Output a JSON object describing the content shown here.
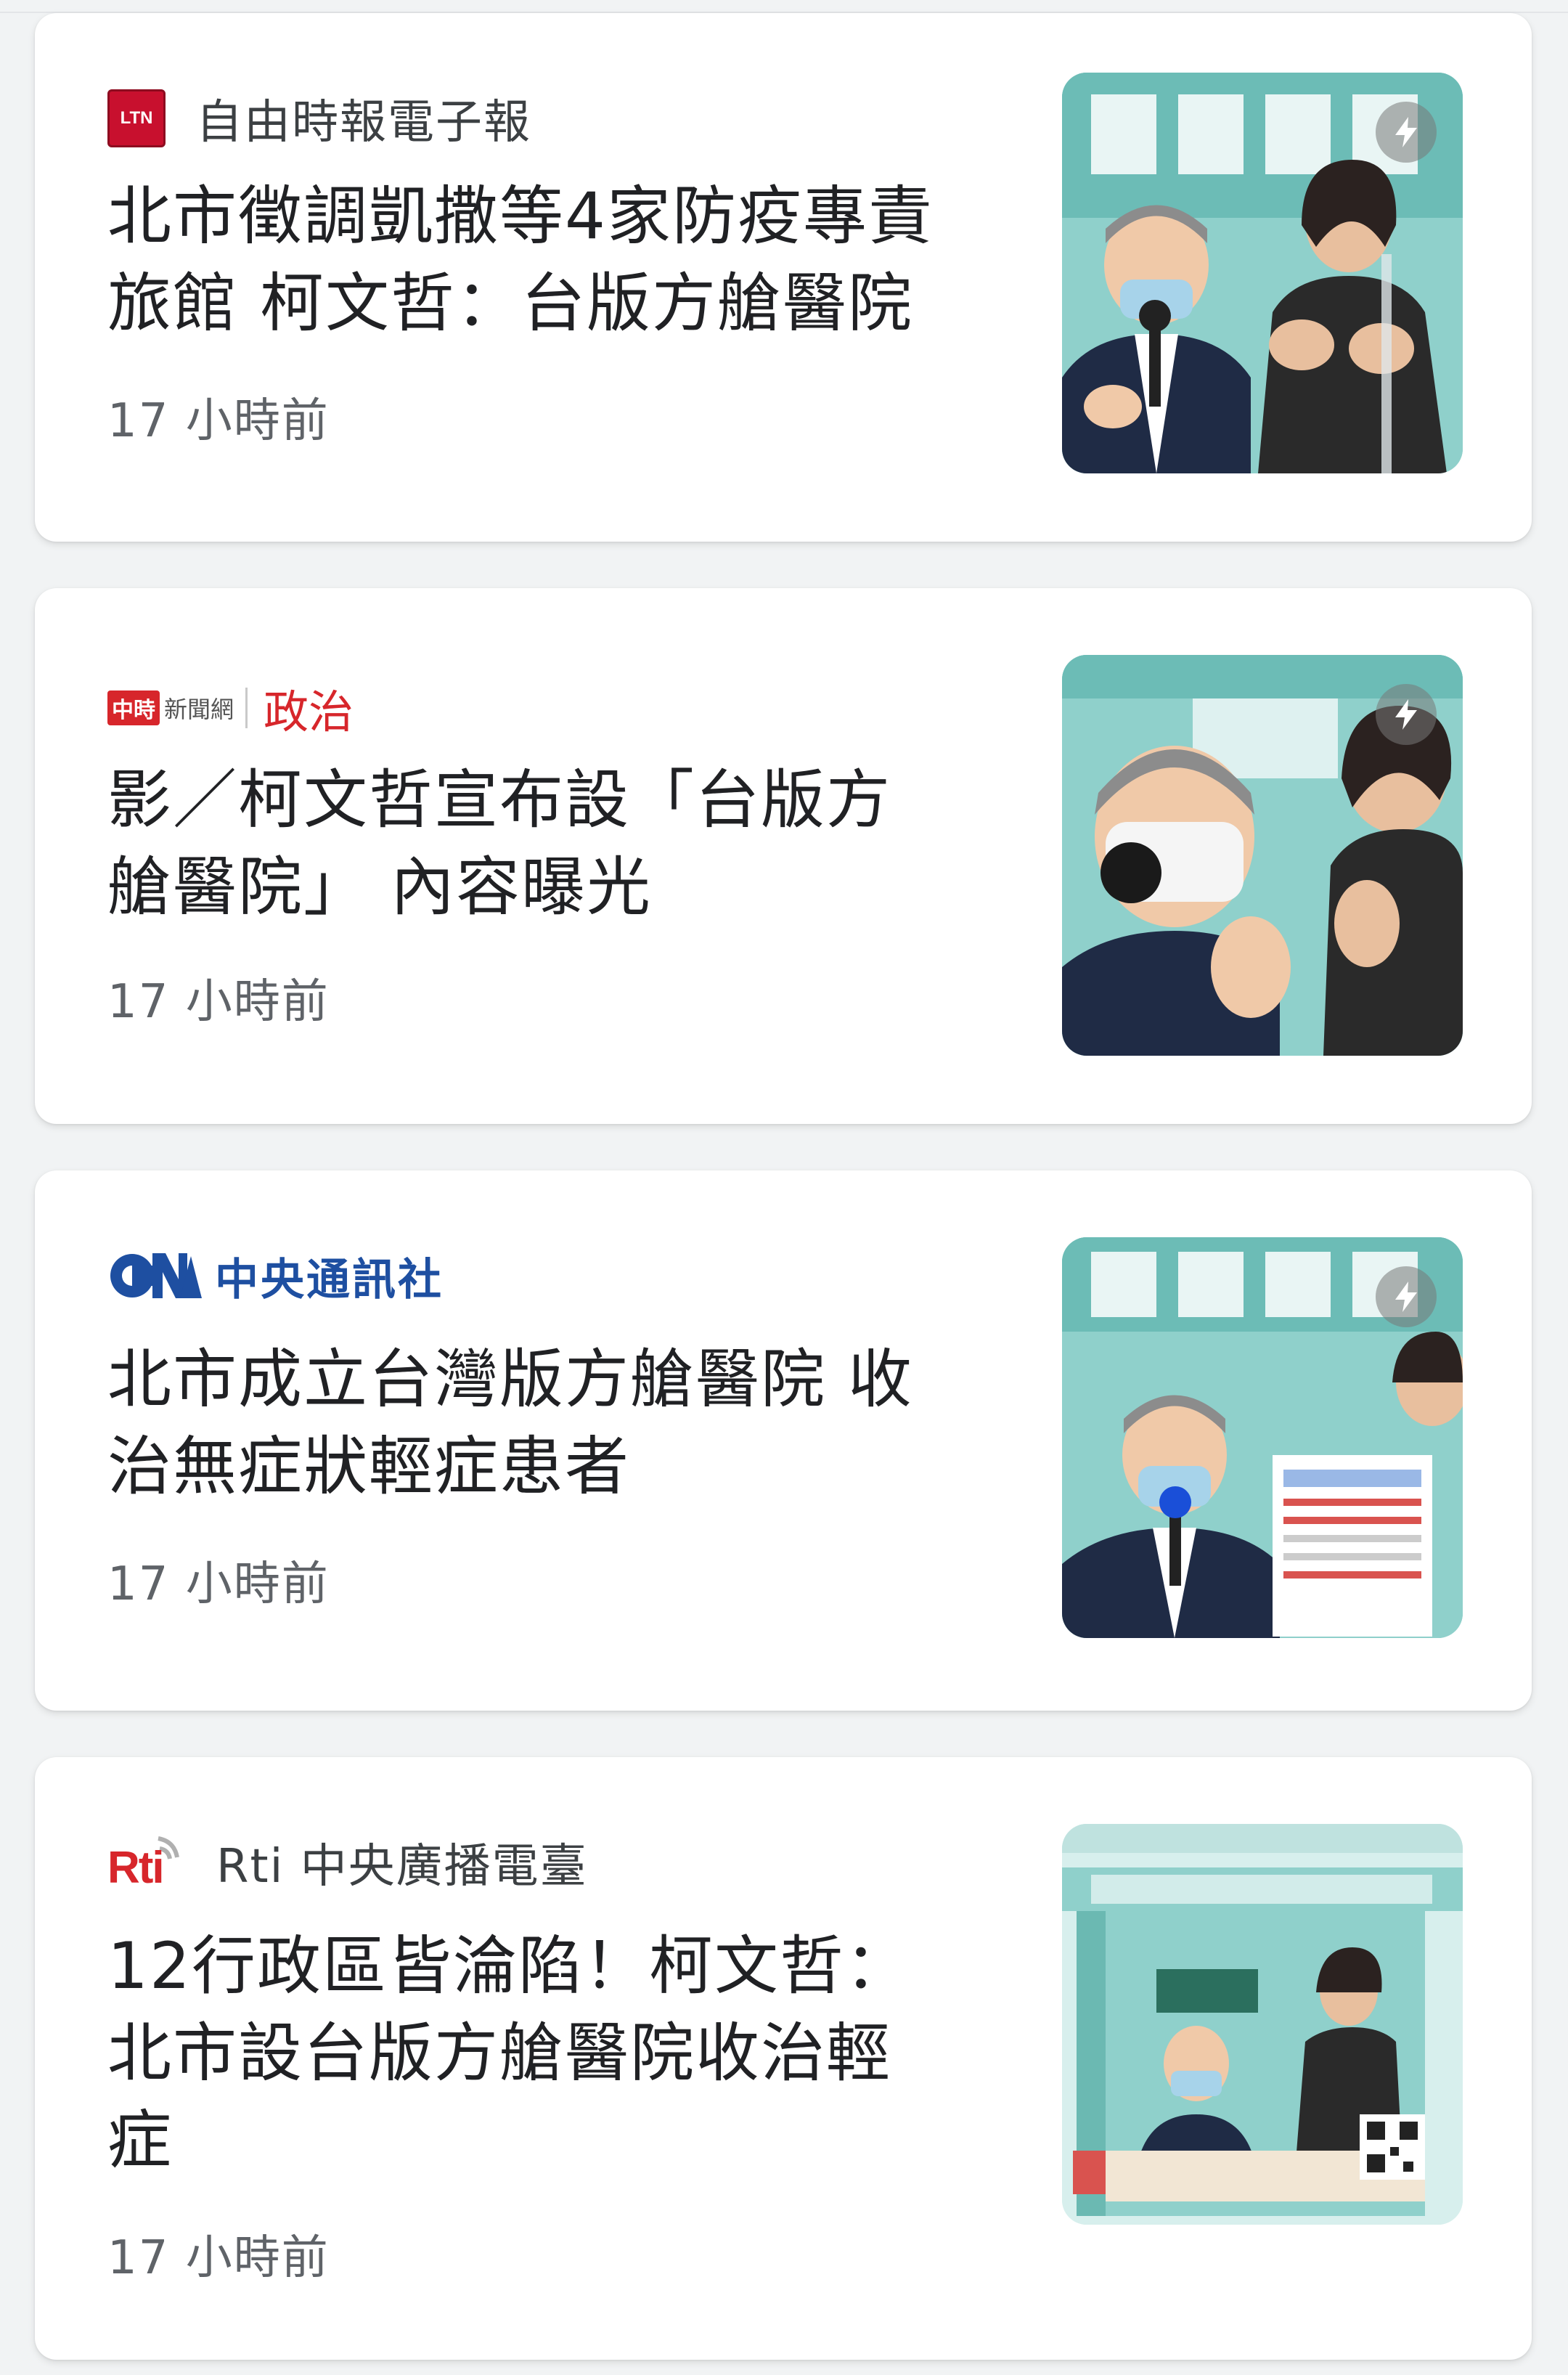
{
  "articles": [
    {
      "source": "自由時報電子報",
      "source_logo_text": "LTN",
      "source_logo_icon": "ltn-logo",
      "headline_line1": "北市徵調凱撒等4家防疫專責",
      "headline_line2": "旅館 柯文哲：台版方艙醫院",
      "time": "17 小時前",
      "thumbnail": "press-conference-photo",
      "amp": true
    },
    {
      "source": "中時新聞網",
      "source_logo_box": "中時",
      "source_logo_text": "新聞網",
      "source_section": "政治",
      "headline_line1": "影／柯文哲宣布設「台版方",
      "headline_line2": "艙醫院」 內容曝光",
      "time": "17 小時前",
      "thumbnail": "press-conference-photo",
      "amp": true
    },
    {
      "source": "中央通訊社",
      "source_logo_icon": "cna-logo",
      "headline_line1": "北市成立台灣版方艙醫院 收",
      "headline_line2": "治無症狀輕症患者",
      "time": "17 小時前",
      "thumbnail": "press-conference-photo",
      "amp": true
    },
    {
      "source": "Rti 中央廣播電臺",
      "source_logo_text": "Rti",
      "source_logo_icon": "rti-logo",
      "headline_line1": "12行政區皆淪陷！柯文哲：",
      "headline_line2": "北市設台版方艙醫院收治輕",
      "headline_line3": "症",
      "time": "17 小時前",
      "thumbnail": "livestream-screenshot",
      "amp": false
    }
  ],
  "colors": {
    "background": "#f1f3f4",
    "card": "#ffffff",
    "headline": "#202124",
    "meta": "#5f6368",
    "ltn_red": "#c8102e",
    "chinatimes_red": "#d7262b",
    "cna_blue": "#1e4fa1",
    "thumb_teal": "#7fc6c0"
  }
}
